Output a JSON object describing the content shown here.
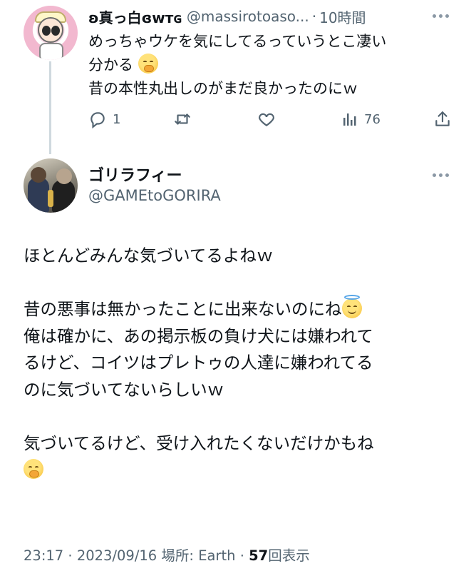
{
  "reply": {
    "display_name": "ʚ真っ白ɞᴡᴛɢ",
    "handle": "@massirotoaso...",
    "separator": "·",
    "time": "10時間",
    "text_lines": [
      "めっちゃウケを気にしてるっていうとこ凄い",
      "分かる",
      "昔の本性丸出しのがまだ良かったのにｗ"
    ],
    "emoji_after_line2": "hand-over-mouth-emoji",
    "actions": {
      "reply_count": "1",
      "retweet_count": "",
      "like_count": "",
      "view_count": "76"
    }
  },
  "tweet": {
    "display_name": "ゴリラフィー",
    "handle": "@GAMEtoGORIRA",
    "lines": {
      "l1": "ほとんどみんな気づいてるよねｗ",
      "l2": "昔の悪事は無かったことに出来ないのにね",
      "l3": "俺は確かに、あの掲示板の負け犬には嫌われて",
      "l4": "るけど、コイツはプレトゥの人達に嫌われてる",
      "l5": "のに気づいてないらしいｗ",
      "l6": "気づいてるけど、受け入れたくないだけかもね"
    },
    "emojis": [
      "smiling-face-with-halo-emoji",
      "hand-over-mouth-emoji"
    ],
    "meta": {
      "time": "23:17",
      "separator": "·",
      "date": "2023/09/16",
      "location": "場所: Earth",
      "views": "57",
      "views_label": "回表示"
    }
  },
  "colors": {
    "text": "#0f1419",
    "secondary": "#536471",
    "thread_line": "#cfd9de",
    "background": "#ffffff"
  }
}
